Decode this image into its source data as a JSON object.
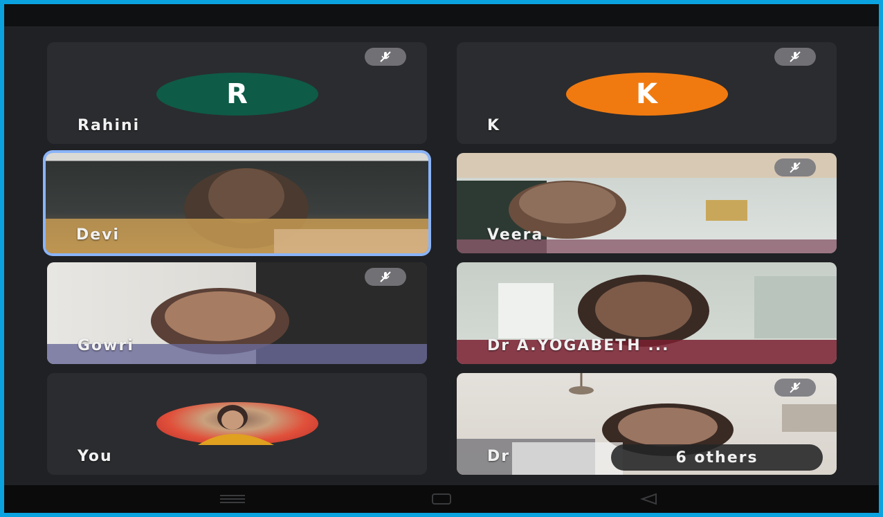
{
  "participants": [
    {
      "name": "Rahini",
      "initial": "R",
      "avatar_color": "#0e5b47",
      "muted": true
    },
    {
      "name": "K",
      "initial": "K",
      "avatar_color": "#f07a10",
      "muted": true
    },
    {
      "name": "Devi",
      "muted": false,
      "speaking": true
    },
    {
      "name": "Veera",
      "muted": true
    },
    {
      "name": "Gowri",
      "muted": true
    },
    {
      "name": "Dr A.YOGABETH ...",
      "muted": false
    },
    {
      "name": "You",
      "muted": false
    },
    {
      "name": "Dr",
      "muted": true
    }
  ],
  "others_label": "6 others",
  "icons": {
    "mute": "mic-off-icon",
    "nav": [
      "menu-icon",
      "home-square-icon",
      "back-triangle-icon"
    ]
  },
  "colors": {
    "active_border": "#8ab4f8",
    "frame_border": "#0aa3e0"
  }
}
